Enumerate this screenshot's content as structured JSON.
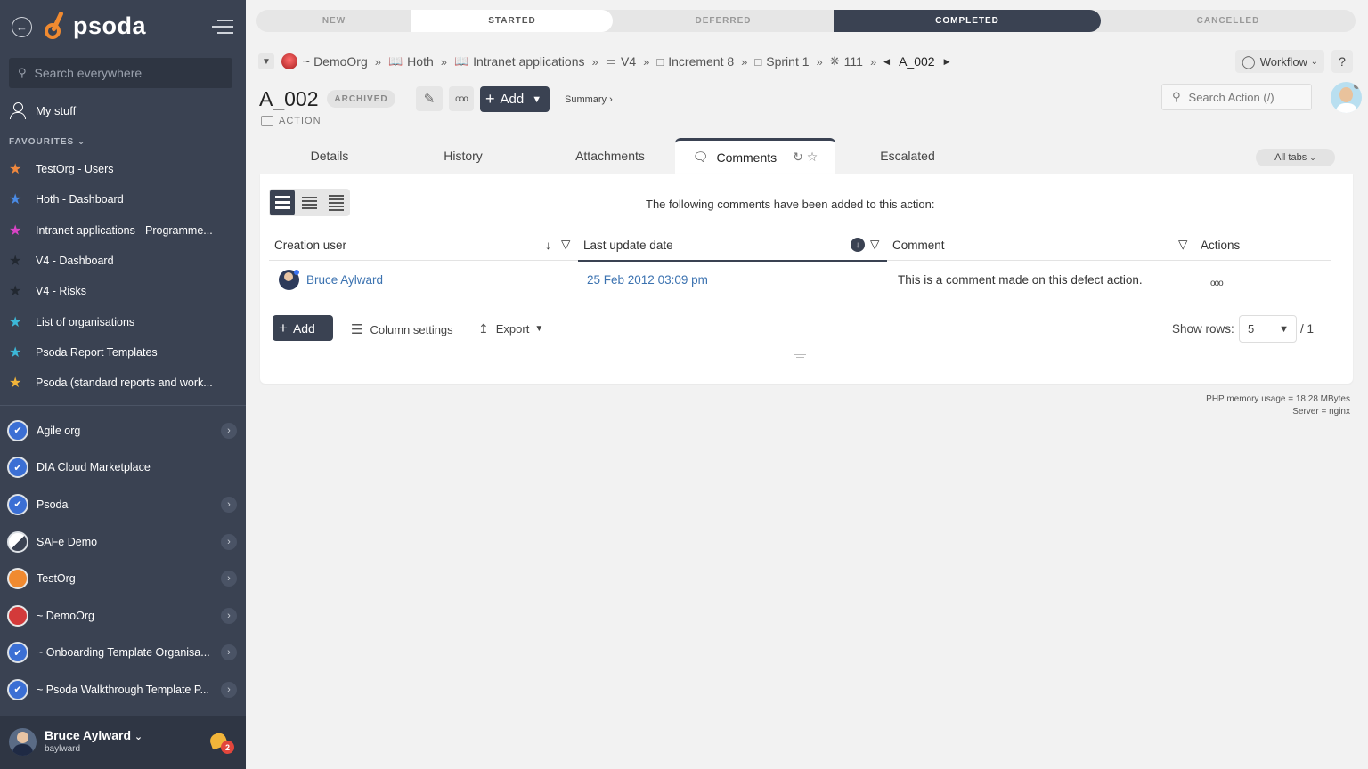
{
  "sidebar": {
    "logo": "psoda",
    "search_placeholder": "Search everywhere",
    "my_stuff": "My stuff",
    "favourites_label": "FAVOURITES",
    "favourites": [
      {
        "label": "TestOrg - Users",
        "color": "#f0883e"
      },
      {
        "label": "Hoth - Dashboard",
        "color": "#4a8be6"
      },
      {
        "label": "Intranet applications - Programme...",
        "color": "#d944c6"
      },
      {
        "label": "V4 - Dashboard",
        "color": "#222831"
      },
      {
        "label": "V4 - Risks",
        "color": "#222831"
      },
      {
        "label": "List of organisations",
        "color": "#3cb8d8"
      },
      {
        "label": "Psoda Report Templates",
        "color": "#3cb8d8"
      },
      {
        "label": "Psoda (standard reports and work...",
        "color": "#f2b53a"
      }
    ],
    "organisations": [
      {
        "label": "Agile org",
        "style": "check",
        "color": "#3b6fd4",
        "chevron": true
      },
      {
        "label": "DIA Cloud Marketplace",
        "style": "check",
        "color": "#3b6fd4",
        "chevron": false
      },
      {
        "label": "Psoda",
        "style": "check",
        "color": "#3b6fd4",
        "chevron": true
      },
      {
        "label": "SAFe Demo",
        "style": "half",
        "color": "#dde1e6",
        "chevron": true
      },
      {
        "label": "TestOrg",
        "style": "solid",
        "color": "#f08a30",
        "chevron": true
      },
      {
        "label": "~ DemoOrg",
        "style": "solid",
        "color": "#d33a3a",
        "chevron": true
      },
      {
        "label": "~ Onboarding Template Organisa...",
        "style": "check",
        "color": "#3b6fd4",
        "chevron": true
      },
      {
        "label": "~ Psoda Walkthrough Template P...",
        "style": "check",
        "color": "#3b6fd4",
        "chevron": true
      }
    ],
    "user": {
      "name": "Bruce Aylward",
      "username": "baylward",
      "notifications": "2"
    }
  },
  "status": {
    "stages": [
      "NEW",
      "STARTED",
      "DEFERRED",
      "COMPLETED",
      "CANCELLED"
    ]
  },
  "breadcrumb": {
    "items": [
      {
        "label": "~ DemoOrg",
        "icon": "org-icon"
      },
      {
        "label": "Hoth",
        "icon": "book-icon"
      },
      {
        "label": "Intranet applications",
        "icon": "book-icon"
      },
      {
        "label": "V4",
        "icon": "folder-icon"
      },
      {
        "label": "Increment 8",
        "icon": "box-icon"
      },
      {
        "label": "Sprint 1",
        "icon": "box-icon"
      },
      {
        "label": "111",
        "icon": "bug-icon"
      }
    ],
    "current": "A_002"
  },
  "header": {
    "workflow_label": "Workflow",
    "help_label": "?",
    "title": "A_002",
    "badge": "ARCHIVED",
    "subtype": "ACTION",
    "add_label": "Add",
    "summary_label": "Summary ›",
    "search_placeholder": "Search Action (/)"
  },
  "tabs": {
    "items": [
      "Details",
      "History",
      "Attachments",
      "Comments",
      "Escalated"
    ],
    "active": "Comments",
    "all_tabs": "All tabs"
  },
  "comments": {
    "intro": "The following comments have been added to this action:",
    "columns": [
      "Creation user",
      "Last update date",
      "Comment",
      "Actions"
    ],
    "rows": [
      {
        "user": "Bruce Aylward",
        "date": "25 Feb 2012 03:09 pm",
        "comment": "This is a comment made on this defect action."
      }
    ],
    "add_label": "Add",
    "column_settings": "Column settings",
    "export_label": "Export",
    "show_rows_label": "Show rows:",
    "rows_value": "5",
    "pages": "/ 1"
  },
  "footer": {
    "memory": "PHP memory usage = 18.28 MBytes",
    "server": "Server = nginx"
  }
}
